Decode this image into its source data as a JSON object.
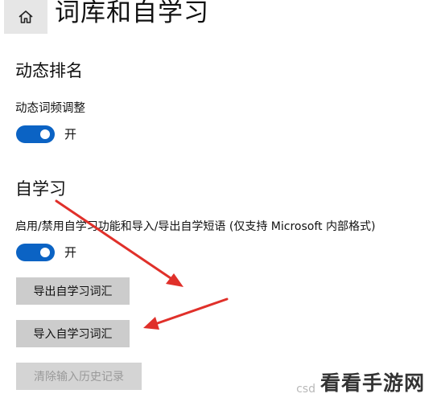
{
  "header": {
    "home_icon": "home-icon",
    "title": "词库和自学习"
  },
  "dynamic_ranking": {
    "section_title": "动态排名",
    "setting_label": "动态词频调整",
    "toggle_state": "开",
    "toggle_on": true
  },
  "self_learning": {
    "section_title": "自学习",
    "setting_label": "启用/禁用自学习功能和导入/导出自学短语 (仅支持 Microsoft 内部格式)",
    "toggle_state": "开",
    "toggle_on": true,
    "buttons": {
      "export_label": "导出自学习词汇",
      "import_label": "导入自学习词汇",
      "clear_label": "清除输入历史记录"
    }
  },
  "colors": {
    "accent": "#0b63c4",
    "annotation_arrow": "#e0302a",
    "button_bg": "#cccccc"
  },
  "watermark": {
    "prefix": "csd",
    "text": "看看手游网"
  }
}
